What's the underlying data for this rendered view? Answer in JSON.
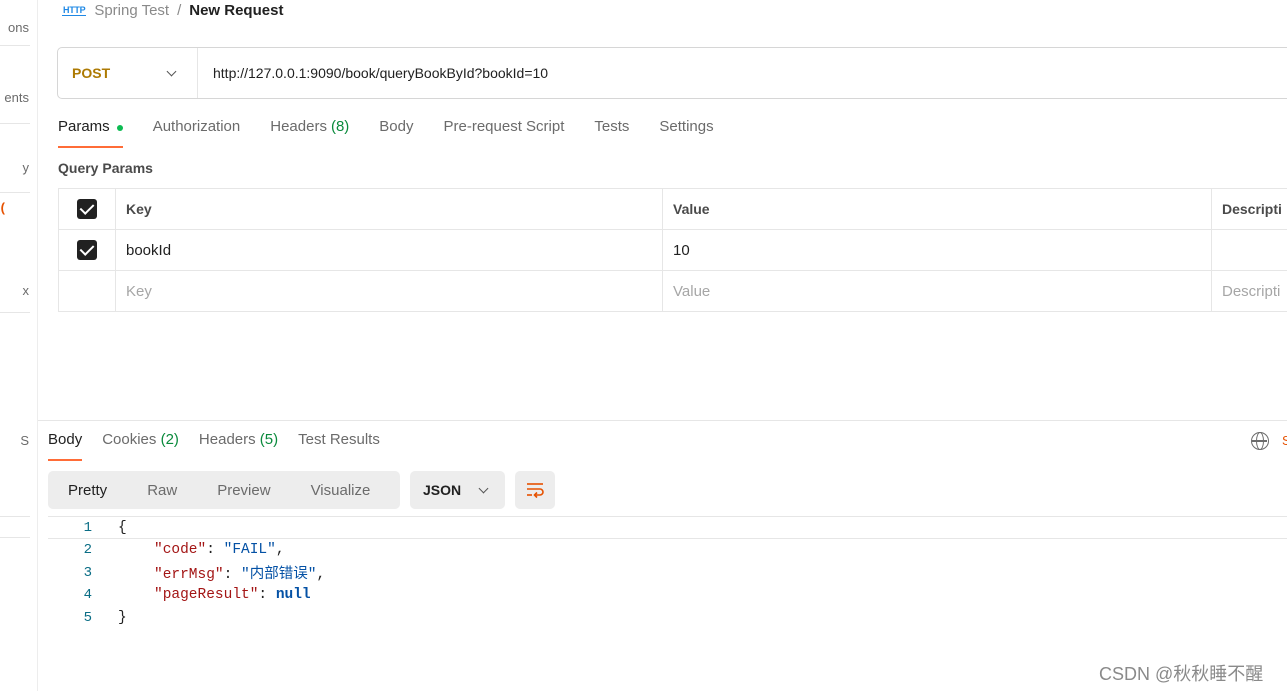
{
  "sidebar": {
    "fragments": [
      "ons",
      "ents",
      "y",
      "(",
      "x",
      "S"
    ]
  },
  "header": {
    "icon": "HTTP",
    "parent": "Spring Test",
    "separator": "/",
    "current": "New Request"
  },
  "request": {
    "method": "POST",
    "url": "http://127.0.0.1:9090/book/queryBookById?bookId=10"
  },
  "request_tabs": [
    {
      "label": "Params",
      "count": "",
      "active": true
    },
    {
      "label": "Authorization",
      "count": ""
    },
    {
      "label": "Headers",
      "count": "(8)"
    },
    {
      "label": "Body",
      "count": ""
    },
    {
      "label": "Pre-request Script",
      "count": ""
    },
    {
      "label": "Tests",
      "count": ""
    },
    {
      "label": "Settings",
      "count": ""
    }
  ],
  "query_params": {
    "title": "Query Params",
    "columns": [
      "Key",
      "Value",
      "Descripti"
    ],
    "rows": [
      {
        "checked": true,
        "key": "bookId",
        "value": "10",
        "description": ""
      }
    ],
    "placeholder": {
      "key": "Key",
      "value": "Value",
      "description": "Descripti"
    }
  },
  "response_tabs": [
    {
      "label": "Body",
      "count": "",
      "active": true
    },
    {
      "label": "Cookies",
      "count": "(2)"
    },
    {
      "label": "Headers",
      "count": "(5)"
    },
    {
      "label": "Test Results",
      "count": ""
    }
  ],
  "view_modes": [
    "Pretty",
    "Raw",
    "Preview",
    "Visualize"
  ],
  "format": "JSON",
  "code_lines": [
    {
      "n": "1",
      "text": "{"
    },
    {
      "n": "2",
      "key": "\"code\"",
      "sep": ": ",
      "val": "\"FAIL\"",
      "end": ","
    },
    {
      "n": "3",
      "key": "\"errMsg\"",
      "sep": ": ",
      "val": "\"内部错误\"",
      "end": ","
    },
    {
      "n": "4",
      "key": "\"pageResult\"",
      "sep": ": ",
      "val": "null",
      "end": ""
    },
    {
      "n": "5",
      "text": "}"
    }
  ],
  "watermark": "CSDN @秋秋睡不醒",
  "colors": {
    "accent": "#ff6c37",
    "method": "#ad7a03",
    "green": "#0cbb52"
  }
}
